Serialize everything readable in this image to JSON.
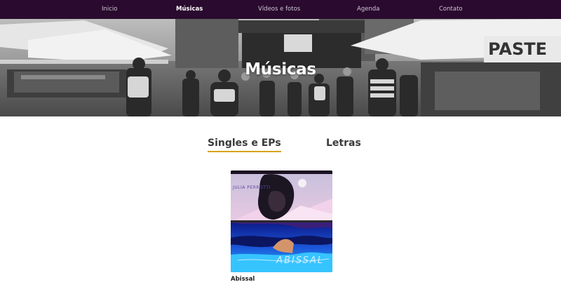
{
  "nav": {
    "items": [
      {
        "label": "Inicio",
        "active": false
      },
      {
        "label": "Músicas",
        "active": true
      },
      {
        "label": "Vídeos e fotos",
        "active": false
      },
      {
        "label": "Agenda",
        "active": false
      },
      {
        "label": "Contato",
        "active": false
      }
    ]
  },
  "hero": {
    "title": "Músicas",
    "sign_text": "PASTE"
  },
  "tabs": [
    {
      "label": "Singles e EPs",
      "active": true
    },
    {
      "label": "Letras",
      "active": false
    }
  ],
  "releases": [
    {
      "title": "Abissal",
      "cover_artist_text": "JULIA PERROTTI",
      "cover_title_text": "ABISSAL"
    }
  ],
  "colors": {
    "nav_bg": "#2a0a2e",
    "tab_underline": "#d8a21a"
  }
}
